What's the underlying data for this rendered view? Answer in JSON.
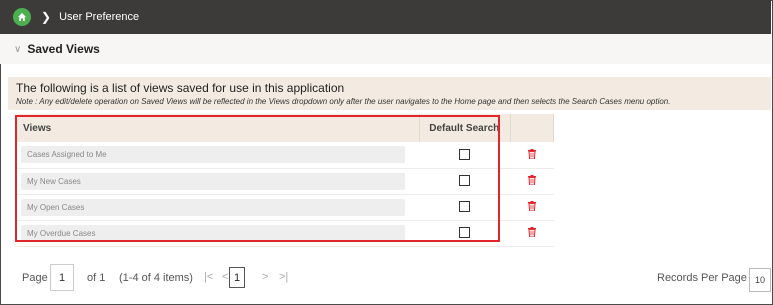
{
  "breadcrumb": {
    "current": "User Preference"
  },
  "section": {
    "title": "Saved Views"
  },
  "info": {
    "main": "The following is a list of views saved for use in this application",
    "note": "Note : Any edit/delete operation on Saved Views will be reflected in the Views dropdown only after the user navigates to the Home page and then selects the Search Cases menu option."
  },
  "table": {
    "headers": {
      "views": "Views",
      "default_search": "Default Search"
    },
    "rows": [
      {
        "view": "Cases Assigned to Me",
        "default_search": false
      },
      {
        "view": "My New Cases",
        "default_search": false
      },
      {
        "view": "My Open Cases",
        "default_search": false
      },
      {
        "view": "My Overdue Cases",
        "default_search": false
      }
    ]
  },
  "pagination": {
    "page_label": "Page",
    "page_input": "1",
    "of_text": "of 1",
    "items_text": "(1-4 of 4 items)",
    "current_page": "1",
    "records_per_page_label": "Records Per Page",
    "records_per_page_value": "10"
  },
  "colors": {
    "topbar": "#3c3b39",
    "home": "#4caf50",
    "highlight": "#e0262b",
    "delete": "#e0262b",
    "header_bg": "#f3ebe1"
  },
  "icons": {
    "home": "home-icon",
    "delete": "trash-icon"
  }
}
